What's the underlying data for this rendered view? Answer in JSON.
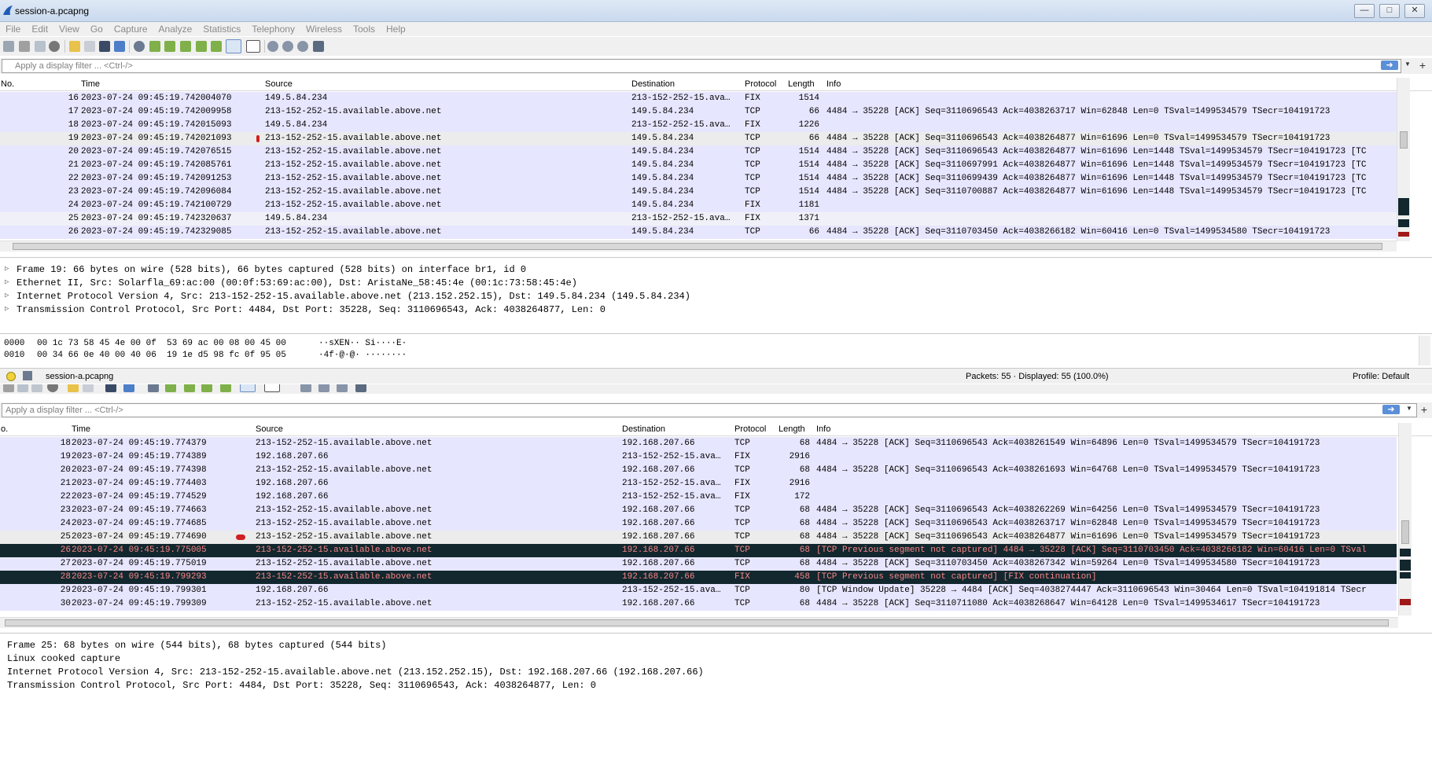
{
  "window": {
    "title": "session-a.pcapng",
    "min": "—",
    "max": "□",
    "close": "✕"
  },
  "menu": [
    "File",
    "Edit",
    "View",
    "Go",
    "Capture",
    "Analyze",
    "Statistics",
    "Telephony",
    "Wireless",
    "Tools",
    "Help"
  ],
  "filter": {
    "placeholder": "Apply a display filter ... <Ctrl-/>",
    "apply": "➜",
    "dropdown": "▼",
    "plus": "+"
  },
  "columns": {
    "no": "No.",
    "no_top": "No.",
    "no_bottom": "o.",
    "time": "Time",
    "source": "Source",
    "destination": "Destination",
    "protocol": "Protocol",
    "length": "Length",
    "info": "Info"
  },
  "top_packets": [
    {
      "no": "16",
      "time": "2023-07-24 09:45:19.742004070",
      "src": "149.5.84.234",
      "dst": "213-152-252-15.ava…",
      "proto": "FIX",
      "len": "1514",
      "info": "",
      "style": "fix"
    },
    {
      "no": "17",
      "time": "2023-07-24 09:45:19.742009958",
      "src": "213-152-252-15.available.above.net",
      "dst": "149.5.84.234",
      "proto": "TCP",
      "len": "66",
      "info": "4484 → 35228 [ACK] Seq=3110696543 Ack=4038263717 Win=62848 Len=0 TSval=1499534579 TSecr=104191723",
      "style": "tcp"
    },
    {
      "no": "18",
      "time": "2023-07-24 09:45:19.742015093",
      "src": "149.5.84.234",
      "dst": "213-152-252-15.ava…",
      "proto": "FIX",
      "len": "1226",
      "info": "",
      "style": "fix"
    },
    {
      "no": "19",
      "time": "2023-07-24 09:45:19.742021093",
      "src": "213-152-252-15.available.above.net",
      "dst": "149.5.84.234",
      "proto": "TCP",
      "len": "66",
      "info": "4484 → 35228 [ACK] Seq=3110696543 Ack=4038264877 Win=61696 Len=0 TSval=1499534579 TSecr=104191723",
      "style": "sel"
    },
    {
      "no": "20",
      "time": "2023-07-24 09:45:19.742076515",
      "src": "213-152-252-15.available.above.net",
      "dst": "149.5.84.234",
      "proto": "TCP",
      "len": "1514",
      "info": "4484 → 35228 [ACK] Seq=3110696543 Ack=4038264877 Win=61696 Len=1448 TSval=1499534579 TSecr=104191723 [TC",
      "style": "tcp"
    },
    {
      "no": "21",
      "time": "2023-07-24 09:45:19.742085761",
      "src": "213-152-252-15.available.above.net",
      "dst": "149.5.84.234",
      "proto": "TCP",
      "len": "1514",
      "info": "4484 → 35228 [ACK] Seq=3110697991 Ack=4038264877 Win=61696 Len=1448 TSval=1499534579 TSecr=104191723 [TC",
      "style": "tcp"
    },
    {
      "no": "22",
      "time": "2023-07-24 09:45:19.742091253",
      "src": "213-152-252-15.available.above.net",
      "dst": "149.5.84.234",
      "proto": "TCP",
      "len": "1514",
      "info": "4484 → 35228 [ACK] Seq=3110699439 Ack=4038264877 Win=61696 Len=1448 TSval=1499534579 TSecr=104191723 [TC",
      "style": "tcp"
    },
    {
      "no": "23",
      "time": "2023-07-24 09:45:19.742096084",
      "src": "213-152-252-15.available.above.net",
      "dst": "149.5.84.234",
      "proto": "TCP",
      "len": "1514",
      "info": "4484 → 35228 [ACK] Seq=3110700887 Ack=4038264877 Win=61696 Len=1448 TSval=1499534579 TSecr=104191723 [TC",
      "style": "tcp"
    },
    {
      "no": "24",
      "time": "2023-07-24 09:45:19.742100729",
      "src": "213-152-252-15.available.above.net",
      "dst": "149.5.84.234",
      "proto": "FIX",
      "len": "1181",
      "info": "",
      "style": "fix"
    },
    {
      "no": "25",
      "time": "2023-07-24 09:45:19.742320637",
      "src": "149.5.84.234",
      "dst": "213-152-252-15.ava…",
      "proto": "FIX",
      "len": "1371",
      "info": "",
      "style": "light"
    },
    {
      "no": "26",
      "time": "2023-07-24 09:45:19.742329085",
      "src": "213-152-252-15.available.above.net",
      "dst": "149.5.84.234",
      "proto": "TCP",
      "len": "66",
      "info": "4484 → 35228 [ACK] Seq=3110703450 Ack=4038266182 Win=60416 Len=0 TSval=1499534580 TSecr=104191723",
      "style": "tcp"
    }
  ],
  "top_details": [
    "Frame 19: 66 bytes on wire (528 bits), 66 bytes captured (528 bits) on interface br1, id 0",
    "Ethernet II, Src: Solarfla_69:ac:00 (00:0f:53:69:ac:00), Dst: AristaNe_58:45:4e (00:1c:73:58:45:4e)",
    "Internet Protocol Version 4, Src: 213-152-252-15.available.above.net (213.152.252.15), Dst: 149.5.84.234 (149.5.84.234)",
    "Transmission Control Protocol, Src Port: 4484, Dst Port: 35228, Seq: 3110696543, Ack: 4038264877, Len: 0"
  ],
  "hex": [
    {
      "offset": "0000",
      "bytes": "00 1c 73 58 45 4e 00 0f  53 69 ac 00 08 00 45 00",
      "ascii": "··sXEN·· Si····E·"
    },
    {
      "offset": "0010",
      "bytes": "00 34 66 0e 40 00 40 06  19 1e d5 98 fc 0f 95 05",
      "ascii": "·4f·@·@· ········"
    }
  ],
  "status": {
    "file": "session-a.pcapng",
    "packets": "Packets: 55 · Displayed: 55 (100.0%)",
    "profile": "Profile: Default"
  },
  "bottom_packets": [
    {
      "no": "18",
      "time": "2023-07-24 09:45:19.774379",
      "src": "213-152-252-15.available.above.net",
      "dst": "192.168.207.66",
      "proto": "TCP",
      "len": "68",
      "info": "4484 → 35228 [ACK] Seq=3110696543 Ack=4038261549 Win=64896 Len=0 TSval=1499534579 TSecr=104191723",
      "style": "tcp"
    },
    {
      "no": "19",
      "time": "2023-07-24 09:45:19.774389",
      "src": "192.168.207.66",
      "dst": "213-152-252-15.ava…",
      "proto": "FIX",
      "len": "2916",
      "info": "",
      "style": "fix"
    },
    {
      "no": "20",
      "time": "2023-07-24 09:45:19.774398",
      "src": "213-152-252-15.available.above.net",
      "dst": "192.168.207.66",
      "proto": "TCP",
      "len": "68",
      "info": "4484 → 35228 [ACK] Seq=3110696543 Ack=4038261693 Win=64768 Len=0 TSval=1499534579 TSecr=104191723",
      "style": "tcp"
    },
    {
      "no": "21",
      "time": "2023-07-24 09:45:19.774403",
      "src": "192.168.207.66",
      "dst": "213-152-252-15.ava…",
      "proto": "FIX",
      "len": "2916",
      "info": "",
      "style": "fix"
    },
    {
      "no": "22",
      "time": "2023-07-24 09:45:19.774529",
      "src": "192.168.207.66",
      "dst": "213-152-252-15.ava…",
      "proto": "FIX",
      "len": "172",
      "info": "",
      "style": "fix"
    },
    {
      "no": "23",
      "time": "2023-07-24 09:45:19.774663",
      "src": "213-152-252-15.available.above.net",
      "dst": "192.168.207.66",
      "proto": "TCP",
      "len": "68",
      "info": "4484 → 35228 [ACK] Seq=3110696543 Ack=4038262269 Win=64256 Len=0 TSval=1499534579 TSecr=104191723",
      "style": "tcp"
    },
    {
      "no": "24",
      "time": "2023-07-24 09:45:19.774685",
      "src": "213-152-252-15.available.above.net",
      "dst": "192.168.207.66",
      "proto": "TCP",
      "len": "68",
      "info": "4484 → 35228 [ACK] Seq=3110696543 Ack=4038263717 Win=62848 Len=0 TSval=1499534579 TSecr=104191723",
      "style": "tcp"
    },
    {
      "no": "25",
      "time": "2023-07-24 09:45:19.774690",
      "src": "213-152-252-15.available.above.net",
      "dst": "192.168.207.66",
      "proto": "TCP",
      "len": "68",
      "info": "4484 → 35228 [ACK] Seq=3110696543 Ack=4038264877 Win=61696 Len=0 TSval=1499534579 TSecr=104191723",
      "style": "sel"
    },
    {
      "no": "26",
      "time": "2023-07-24 09:45:19.775005",
      "src": "213-152-252-15.available.above.net",
      "dst": "192.168.207.66",
      "proto": "TCP",
      "len": "68",
      "info": "[TCP Previous segment not captured] 4484 → 35228 [ACK] Seq=3110703450 Ack=4038266182 Win=60416 Len=0 TSval",
      "style": "warn"
    },
    {
      "no": "27",
      "time": "2023-07-24 09:45:19.775019",
      "src": "213-152-252-15.available.above.net",
      "dst": "192.168.207.66",
      "proto": "TCP",
      "len": "68",
      "info": "4484 → 35228 [ACK] Seq=3110703450 Ack=4038267342 Win=59264 Len=0 TSval=1499534580 TSecr=104191723",
      "style": "tcp"
    },
    {
      "no": "28",
      "time": "2023-07-24 09:45:19.799293",
      "src": "213-152-252-15.available.above.net",
      "dst": "192.168.207.66",
      "proto": "FIX",
      "len": "458",
      "info": "[TCP Previous segment not captured] [FIX continuation]",
      "style": "warn"
    },
    {
      "no": "29",
      "time": "2023-07-24 09:45:19.799301",
      "src": "192.168.207.66",
      "dst": "213-152-252-15.ava…",
      "proto": "TCP",
      "len": "80",
      "info": "[TCP Window Update] 35228 → 4484 [ACK] Seq=4038274447 Ack=3110696543 Win=30464 Len=0 TSval=104191814 TSecr",
      "style": "tcp"
    },
    {
      "no": "30",
      "time": "2023-07-24 09:45:19.799309",
      "src": "213-152-252-15.available.above.net",
      "dst": "192.168.207.66",
      "proto": "TCP",
      "len": "68",
      "info": "4484 → 35228 [ACK] Seq=3110711080 Ack=4038268647 Win=64128 Len=0 TSval=1499534617 TSecr=104191723",
      "style": "tcp"
    }
  ],
  "bottom_details": [
    "Frame 25: 68 bytes on wire (544 bits), 68 bytes captured (544 bits)",
    "Linux cooked capture",
    "Internet Protocol Version 4, Src: 213-152-252-15.available.above.net (213.152.252.15), Dst: 192.168.207.66 (192.168.207.66)",
    "Transmission Control Protocol, Src Port: 4484, Dst Port: 35228, Seq: 3110696543, Ack: 4038264877, Len: 0"
  ]
}
